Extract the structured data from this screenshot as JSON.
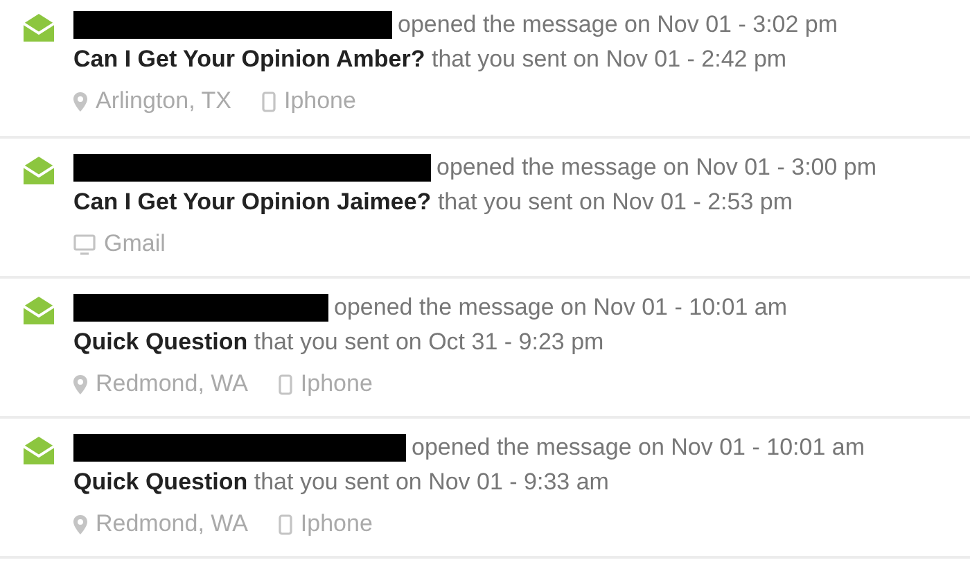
{
  "events": [
    {
      "action": "opened the message on Nov 01 - 3:02 pm",
      "subject": "Can I Get Your Opinion Amber?",
      "sent": "that you sent on Nov 01 - 2:42 pm",
      "location": "Arlington, TX",
      "device": {
        "kind": "phone",
        "label": "Iphone"
      }
    },
    {
      "action": "opened the message on Nov 01 - 3:00 pm",
      "subject": "Can I Get Your Opinion Jaimee?",
      "sent": "that you sent on Nov 01 - 2:53 pm",
      "device": {
        "kind": "desktop",
        "label": "Gmail"
      }
    },
    {
      "action": "opened the message on Nov 01 - 10:01 am",
      "subject": "Quick Question",
      "sent": "that you sent on Oct 31 - 9:23 pm",
      "location": "Redmond, WA",
      "device": {
        "kind": "phone",
        "label": "Iphone"
      }
    },
    {
      "action": "opened the message on Nov 01 - 10:01 am",
      "subject": "Quick Question",
      "sent": "that you sent on Nov 01 - 9:33 am",
      "location": "Redmond, WA",
      "device": {
        "kind": "phone",
        "label": "Iphone"
      }
    }
  ]
}
